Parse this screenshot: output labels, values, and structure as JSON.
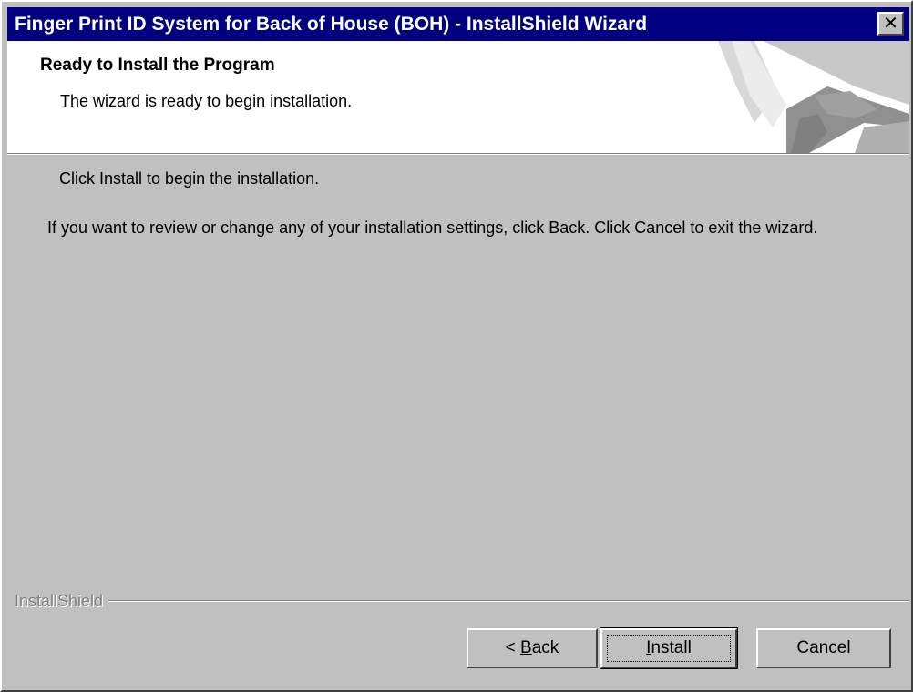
{
  "window": {
    "title": "Finger Print ID System for Back of House (BOH) - InstallShield Wizard",
    "close_glyph": "✕"
  },
  "header": {
    "title": "Ready to Install the Program",
    "subtitle": "The wizard is ready to begin installation."
  },
  "body": {
    "line1": "Click Install to begin the installation.",
    "line2": "If you want to review or change any of your installation settings, click Back. Click Cancel to exit the wizard."
  },
  "footer": {
    "brand": "InstallShield"
  },
  "buttons": {
    "back_prefix": "< ",
    "back_mnemonic": "B",
    "back_rest": "ack",
    "install_mnemonic": "I",
    "install_rest": "nstall",
    "cancel": "Cancel"
  },
  "colors": {
    "titlebar": "#000080",
    "face": "#c0c0c0",
    "header_bg": "#ffffff"
  },
  "icons": {
    "close": "close-icon",
    "header_art": "installshield-banner-graphic"
  }
}
